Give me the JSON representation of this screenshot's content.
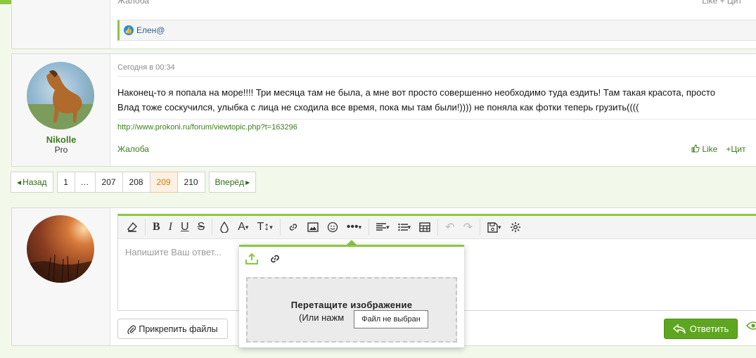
{
  "previous_post": {
    "report_label": "Жалоба",
    "like_label": "Like",
    "quote_label": "+ Цит",
    "reactions_user": "Елен@"
  },
  "post": {
    "username": "Nikolle",
    "user_title": "Pro",
    "date": "Сегодня в 00:34",
    "body_line1": "Наконец-то я попала на море!!!! Три месяца там не была, а мне вот просто совершенно необходимо туда ездить! Там такая красота, просто",
    "body_line2": "Влад тоже соскучился, улыбка с лица не сходила все время, пока мы там были!)))) не поняла как фотки теперь грузить((((",
    "link": "http://www.prokoni.ru/forum/viewtopic.php?t=163296",
    "report_label": "Жалоба",
    "like_label": "Like",
    "quote_label": "Цит"
  },
  "pagination": {
    "prev_label": "Назад",
    "next_label": "Вперёд",
    "pages": [
      "1",
      "…",
      "207",
      "208",
      "209",
      "210"
    ],
    "current_page": "209"
  },
  "reply": {
    "placeholder": "Напишите Ваш ответ...",
    "attach_label": "Прикрепить файлы",
    "submit_label": "Ответить"
  },
  "image_popup": {
    "drop_title": "Перетащите изображение",
    "drop_sub": "(Или нажм",
    "tooltip": "Файл не выбран"
  },
  "colors": {
    "accent": "#8dc63f",
    "link": "#3e7d1f",
    "current_page": "#d67b00",
    "reply_button": "#5fa620"
  }
}
